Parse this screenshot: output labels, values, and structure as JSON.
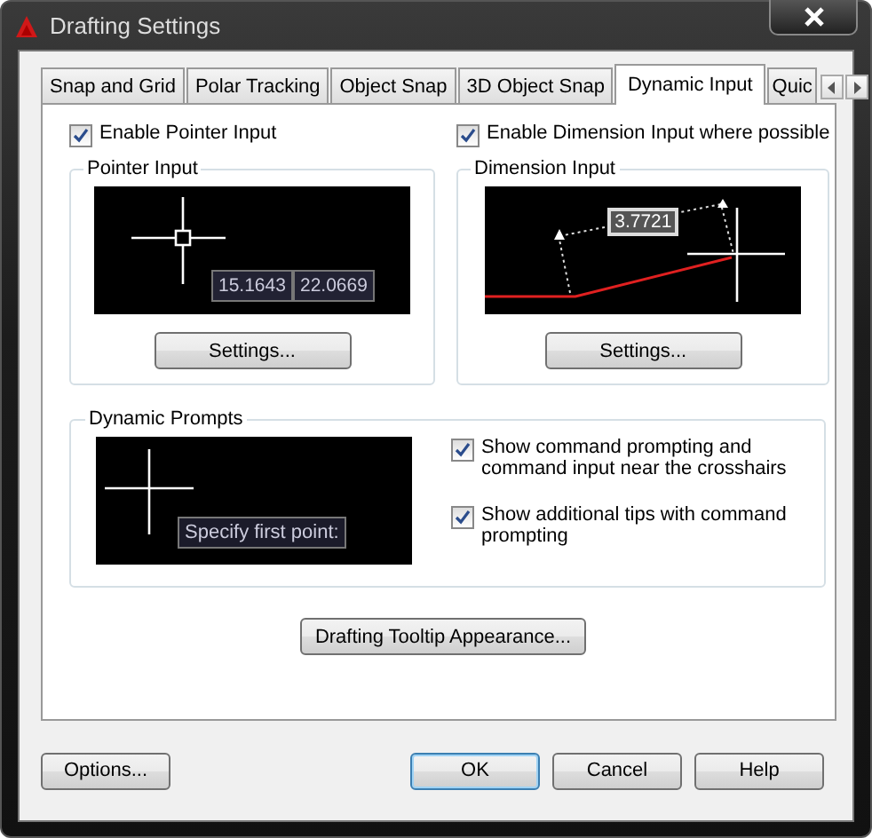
{
  "window": {
    "title": "Drafting Settings"
  },
  "tabs": [
    {
      "label": "Snap and Grid",
      "selected": false
    },
    {
      "label": "Polar Tracking",
      "selected": false
    },
    {
      "label": "Object Snap",
      "selected": false
    },
    {
      "label": "3D Object Snap",
      "selected": false
    },
    {
      "label": "Dynamic Input",
      "selected": true
    },
    {
      "label": "Quic",
      "selected": false
    }
  ],
  "pointer_input": {
    "enable": {
      "label": "Enable Pointer Input",
      "checked": true
    },
    "group_title": "Pointer Input",
    "preview": {
      "x_value": "15.1643",
      "y_value": "22.0669"
    },
    "settings_button": "Settings..."
  },
  "dimension_input": {
    "enable": {
      "label": "Enable Dimension Input where possible",
      "checked": true
    },
    "group_title": "Dimension Input",
    "preview": {
      "value": "3.7721"
    },
    "settings_button": "Settings..."
  },
  "dynamic_prompts": {
    "group_title": "Dynamic Prompts",
    "preview": {
      "prompt": "Specify first point:"
    },
    "options": [
      {
        "label": "Show command prompting and command input near the crosshairs",
        "checked": true
      },
      {
        "label": "Show additional tips with command prompting",
        "checked": true
      }
    ]
  },
  "tooltip_button": "Drafting Tooltip Appearance...",
  "footer": {
    "left_buttons": [
      "Options..."
    ],
    "right_buttons": [
      "OK",
      "Cancel",
      "Help"
    ]
  }
}
